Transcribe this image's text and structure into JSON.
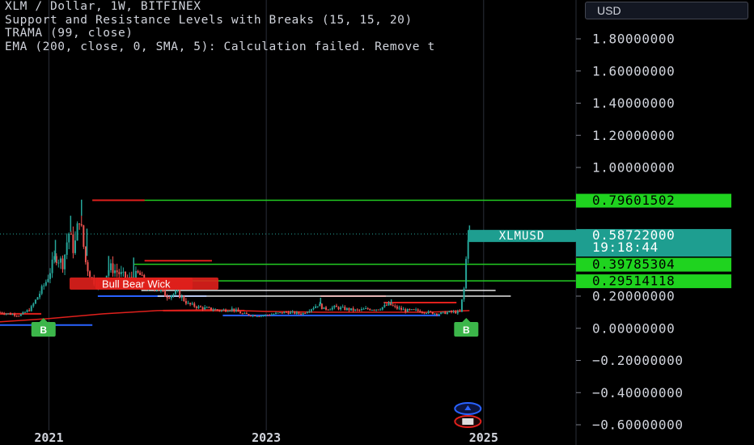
{
  "legend": {
    "symbol": "XLM / Dollar, 1W, BITFINEX",
    "line1": " Support and Resistance Levels with Breaks (15, 15, 20)",
    "line2": "TRAMA (99, close)",
    "line3": "EMA (200, close, 0, SMA, 5): Calculation failed. Remove t"
  },
  "currency": "USD",
  "colors": {
    "background": "#000000",
    "green": "#22cc22",
    "red": "#e0201c",
    "blue": "#2962ff",
    "teal": "#26a69a",
    "up_candle": "#26a69a",
    "down_candle": "#ef5350",
    "ema": "#e0201c",
    "grid": "#2a2e39",
    "label_green": "#1fd31f",
    "label_teal": "#1e9e90"
  },
  "price_labels": [
    {
      "text": "0.79601502",
      "value": 0.796,
      "style": "green"
    },
    {
      "text": "0.39785304",
      "value": 0.398,
      "style": "green"
    },
    {
      "text": "0.29514118",
      "value": 0.295,
      "style": "green"
    }
  ],
  "last_price": {
    "symbol": "XLMUSD",
    "price": "0.58722000",
    "countdown": "19:18:44",
    "value": 0.587
  },
  "break_labels": [
    {
      "text": "B",
      "x": 2020.95,
      "color": "green"
    },
    {
      "text": "B",
      "x": 2024.84,
      "color": "green"
    }
  ],
  "overlap_label": "Bull Bear Wick",
  "chart_data": {
    "type": "candlestick",
    "ylim": [
      -0.6,
      2.0
    ],
    "y_ticks": [
      {
        "value": 1.8,
        "label": "1.80000000"
      },
      {
        "value": 1.6,
        "label": "1.60000000"
      },
      {
        "value": 1.4,
        "label": "1.40000000"
      },
      {
        "value": 1.2,
        "label": "1.20000000"
      },
      {
        "value": 1.0,
        "label": "1.00000000"
      },
      {
        "value": 0.2,
        "label": "0.20000000"
      },
      {
        "value": 0.0,
        "label": "0.00000000"
      },
      {
        "value": -0.2,
        "label": "−0.20000000"
      },
      {
        "value": -0.4,
        "label": "−0.40000000"
      },
      {
        "value": -0.6,
        "label": "−0.60000000"
      }
    ],
    "x_ticks": [
      {
        "value": 2021,
        "label": "2021"
      },
      {
        "value": 2023,
        "label": "2023"
      },
      {
        "value": 2025,
        "label": "2025"
      }
    ],
    "xlim": [
      2020.55,
      2025.85
    ],
    "price_path": [
      [
        2020.55,
        0.1
      ],
      [
        2020.75,
        0.08
      ],
      [
        2020.85,
        0.12
      ],
      [
        2020.92,
        0.2
      ],
      [
        2021.0,
        0.3
      ],
      [
        2021.08,
        0.45
      ],
      [
        2021.15,
        0.4
      ],
      [
        2021.2,
        0.6
      ],
      [
        2021.25,
        0.48
      ],
      [
        2021.3,
        0.7
      ],
      [
        2021.33,
        0.55
      ],
      [
        2021.36,
        0.4
      ],
      [
        2021.42,
        0.3
      ],
      [
        2021.5,
        0.27
      ],
      [
        2021.58,
        0.38
      ],
      [
        2021.65,
        0.35
      ],
      [
        2021.75,
        0.3
      ],
      [
        2021.85,
        0.34
      ],
      [
        2021.92,
        0.25
      ],
      [
        2022.0,
        0.26
      ],
      [
        2022.1,
        0.2
      ],
      [
        2022.2,
        0.22
      ],
      [
        2022.3,
        0.15
      ],
      [
        2022.4,
        0.13
      ],
      [
        2022.5,
        0.12
      ],
      [
        2022.6,
        0.11
      ],
      [
        2022.7,
        0.12
      ],
      [
        2022.8,
        0.09
      ],
      [
        2022.9,
        0.08
      ],
      [
        2023.0,
        0.08
      ],
      [
        2023.1,
        0.09
      ],
      [
        2023.2,
        0.1
      ],
      [
        2023.35,
        0.09
      ],
      [
        2023.5,
        0.15
      ],
      [
        2023.55,
        0.12
      ],
      [
        2023.65,
        0.13
      ],
      [
        2023.75,
        0.12
      ],
      [
        2023.85,
        0.11
      ],
      [
        2023.95,
        0.12
      ],
      [
        2024.05,
        0.12
      ],
      [
        2024.15,
        0.15
      ],
      [
        2024.2,
        0.13
      ],
      [
        2024.3,
        0.11
      ],
      [
        2024.4,
        0.11
      ],
      [
        2024.5,
        0.1
      ],
      [
        2024.6,
        0.09
      ],
      [
        2024.7,
        0.1
      ],
      [
        2024.8,
        0.1
      ],
      [
        2024.84,
        0.25
      ],
      [
        2024.86,
        0.45
      ],
      [
        2024.87,
        0.587
      ]
    ],
    "wick_highs": [
      [
        2021.06,
        0.55
      ],
      [
        2021.2,
        0.7
      ],
      [
        2021.3,
        0.8
      ],
      [
        2021.35,
        0.62
      ],
      [
        2021.55,
        0.45
      ],
      [
        2021.78,
        0.44
      ],
      [
        2023.5,
        0.19
      ],
      [
        2024.15,
        0.18
      ],
      [
        2024.87,
        0.64
      ]
    ],
    "ema": [
      [
        2020.55,
        0.04
      ],
      [
        2021.0,
        0.06
      ],
      [
        2021.5,
        0.09
      ],
      [
        2022.0,
        0.11
      ],
      [
        2022.5,
        0.115
      ],
      [
        2023.0,
        0.105
      ],
      [
        2023.5,
        0.1
      ],
      [
        2024.0,
        0.1
      ],
      [
        2024.5,
        0.1
      ],
      [
        2024.87,
        0.11
      ]
    ],
    "green_levels": [
      {
        "value": 0.796,
        "x1": 2021.4
      },
      {
        "value": 0.398,
        "x1": 2021.78
      },
      {
        "value": 0.295,
        "x1": 2021.8
      }
    ],
    "red_segments": [
      {
        "value": 0.796,
        "x0": 2021.4,
        "x1": 2021.88
      },
      {
        "value": 0.42,
        "x0": 2021.88,
        "x1": 2022.5
      },
      {
        "value": 0.31,
        "x0": 2021.5,
        "x1": 2022.0
      },
      {
        "value": 0.09,
        "x0": 2020.55,
        "x1": 2020.93
      },
      {
        "value": 0.2,
        "x0": 2023.5,
        "x1": 2024.1
      },
      {
        "value": 0.16,
        "x0": 2024.08,
        "x1": 2024.75
      },
      {
        "value": 0.11,
        "x0": 2022.05,
        "x1": 2022.8
      }
    ],
    "blue_segments": [
      {
        "value": 0.02,
        "x0": 2020.55,
        "x1": 2021.4
      },
      {
        "value": 0.2,
        "x0": 2021.45,
        "x1": 2022.45
      },
      {
        "value": 0.08,
        "x0": 2022.6,
        "x1": 2024.6
      }
    ],
    "white_lines": [
      {
        "value": 0.235,
        "x0": 2021.85,
        "x1": 2025.11
      },
      {
        "value": 0.2,
        "x0": 2022.0,
        "x1": 2025.25
      }
    ]
  }
}
